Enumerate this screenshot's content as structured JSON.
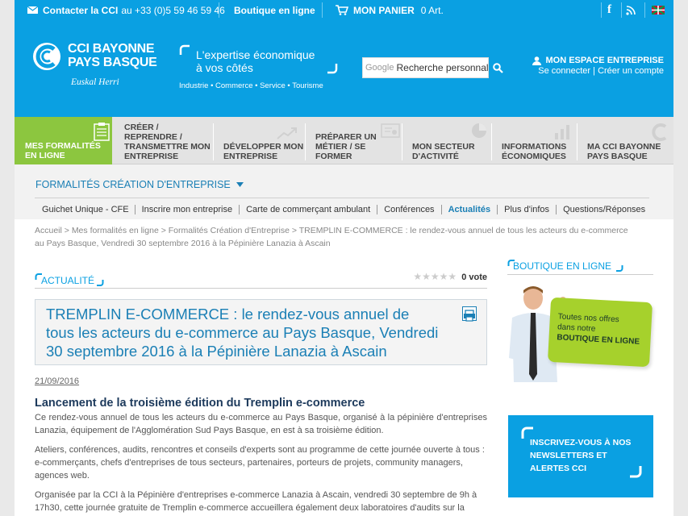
{
  "topbar": {
    "contact_label": "Contacter la CCI",
    "contact_phone": "au +33 (0)5 59 46 59 46",
    "shop_label": "Boutique en ligne",
    "cart_label": "MON PANIER",
    "cart_count": "0 Art."
  },
  "header": {
    "logo_line1": "CCI BAYONNE",
    "logo_line2": "PAYS BASQUE",
    "logo_tagline": "Euskal Herri",
    "slogan_line1": "L'expertise économique",
    "slogan_line2": "à vos côtés",
    "sectors": "Industrie • Commerce • Service • Tourisme",
    "search_brand": "Google",
    "search_value": "Recherche personnal",
    "account_title": "MON ESPACE ENTREPRISE",
    "account_login": "Se connecter",
    "account_sep": "|",
    "account_create": "Créer un compte"
  },
  "nav": {
    "items": [
      {
        "label": "MES FORMALITÉS EN LIGNE"
      },
      {
        "label": "CRÉER / REPRENDRE / TRANSMETTRE MON ENTREPRISE"
      },
      {
        "label": "DÉVELOPPER MON ENTREPRISE"
      },
      {
        "label": "PRÉPARER UN MÉTIER / SE FORMER"
      },
      {
        "label": "MON SECTEUR D'ACTIVITÉ"
      },
      {
        "label": "INFORMATIONS ÉCONOMIQUES"
      },
      {
        "label": "MA CCI BAYONNE PAYS BASQUE"
      }
    ]
  },
  "section": {
    "title": "FORMALITÉS CRÉATION D'ENTREPRISE",
    "tabs": [
      {
        "label": "Guichet Unique - CFE"
      },
      {
        "label": "Inscrire mon entreprise"
      },
      {
        "label": "Carte de commerçant ambulant"
      },
      {
        "label": "Conférences"
      },
      {
        "label": "Actualités"
      },
      {
        "label": "Plus d'infos"
      },
      {
        "label": "Questions/Réponses"
      }
    ]
  },
  "breadcrumb": {
    "line1": "Accueil > Mes formalités en ligne > Formalités Création d'Entreprise > TREMPLIN E-COMMERCE : le rendez-vous annuel de tous les acteurs du e-commerce",
    "line2": "au Pays Basque, Vendredi 30 septembre 2016 à la Pépinière Lanazia à Ascain"
  },
  "article": {
    "category": "ACTUALITÉ",
    "votes": "0 vote",
    "title_line1": "TREMPLIN E-COMMERCE : le rendez-vous annuel de",
    "title_line2": "tous les acteurs du e-commerce au Pays Basque, Vendredi",
    "title_line3": "30 septembre 2016 à la Pépinière Lanazia à Ascain",
    "date": "21/09/2016",
    "subtitle": "Lancement de la troisième édition du Tremplin e-commerce",
    "p1_l1": "Ce rendez-vous annuel de tous les acteurs du e-commerce au Pays Basque, organisé à la pépinière d'entreprises",
    "p1_l2": "Lanazia, équipement de l'Agglomération Sud Pays Basque,  en est à sa troisième édition.",
    "p2_l1": "Ateliers, conférences, audits, rencontres et conseils d'experts sont au programme de cette journée ouverte à tous :",
    "p2_l2": "e-commerçants, chefs d'entreprises de tous secteurs, partenaires, porteurs de projets, community managers,",
    "p2_l3": "agences web.",
    "p3_l1": "Organisée par la CCI à la Pépinière d'entreprises e-commerce Lanazia à Ascain, vendredi 30 septembre de 9h à",
    "p3_l2": "17h30, cette journée gratuite de Tremplin e-commerce accueillera également deux laboratoires d'audits sur la"
  },
  "sidebar": {
    "shop_title": "BOUTIQUE EN LIGNE",
    "promo_line1": "Toutes nos offres",
    "promo_line2": "dans notre",
    "promo_line3": "BOUTIQUE EN LIGNE",
    "newsletter_line1": "INSCRIVEZ-VOUS À NOS",
    "newsletter_line2": "NEWSLETTERS ET",
    "newsletter_line3": "ALERTES CCI"
  },
  "colors": {
    "brand_blue": "#0aa0e2",
    "title_blue": "#1a7fb5",
    "active_green": "#8cc63f",
    "promo_green": "#a6d12c"
  }
}
